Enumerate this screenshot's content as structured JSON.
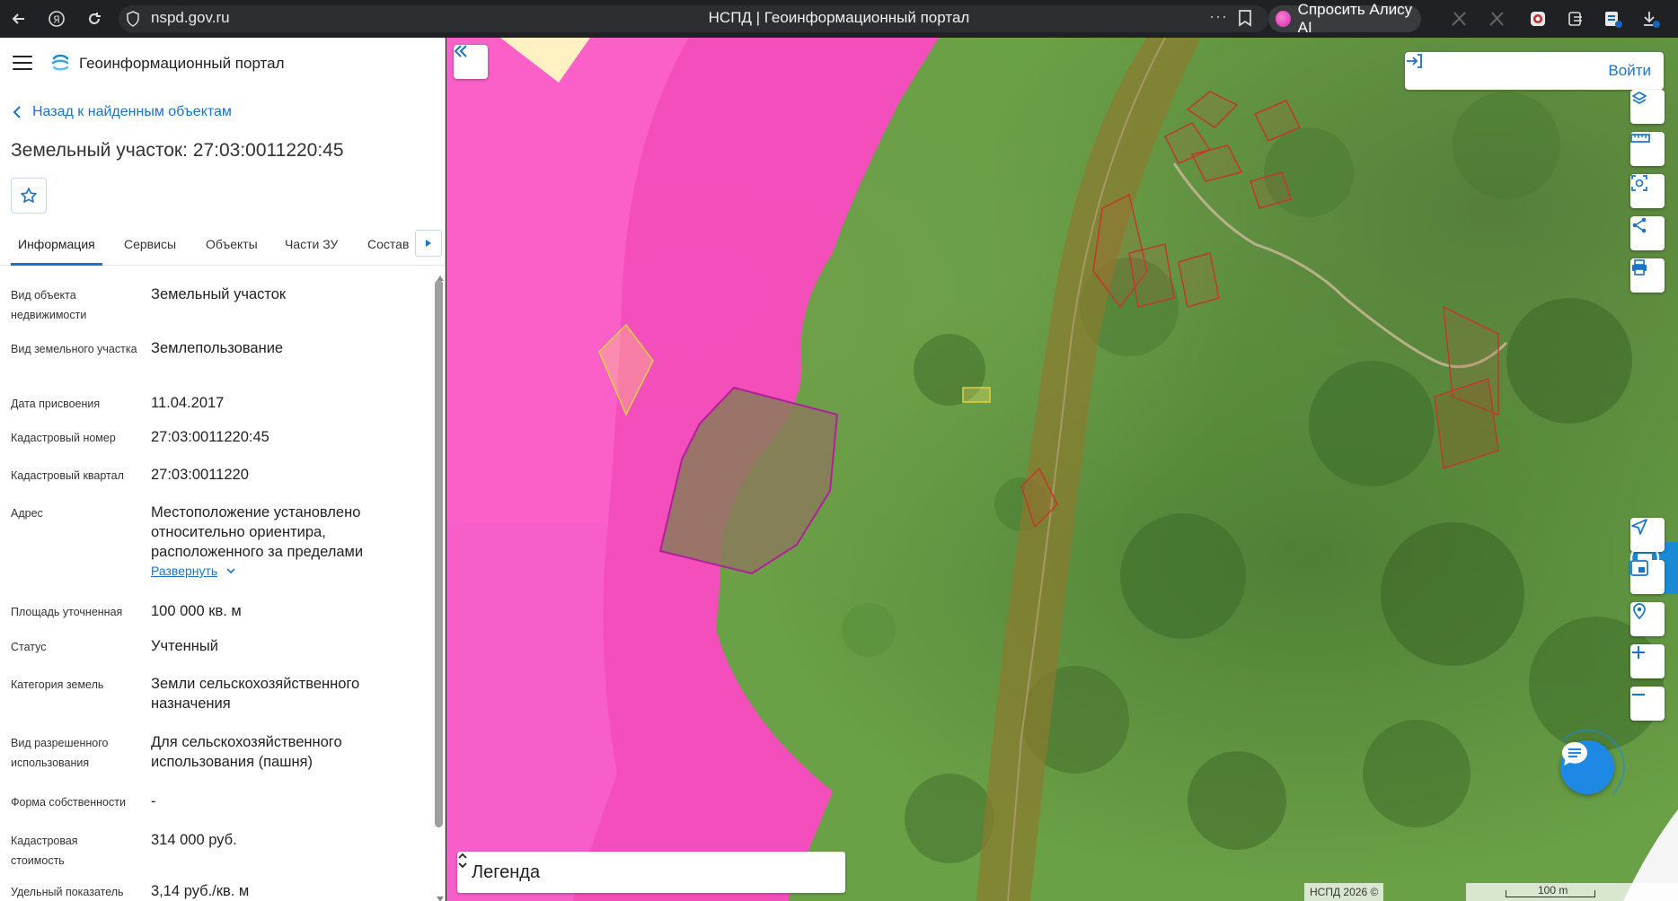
{
  "browser": {
    "url": "nspd.gov.ru",
    "tab_title": "НСПД | Геоинформационный портал",
    "more_label": "···",
    "alice_label": "Спросить Алису AI"
  },
  "header": {
    "portal_title": "Геоинформационный портал"
  },
  "panel": {
    "back_label": "Назад к найденным объектам",
    "title": "Земельный участок: 27:03:0011220:45",
    "tabs": [
      "Информация",
      "Сервисы",
      "Объекты",
      "Части ЗУ",
      "Состав"
    ],
    "expand_label": "Развернуть",
    "attributes": [
      {
        "label": "Вид объекта недвижимости",
        "value": "Земельный участок"
      },
      {
        "label": "Вид земельного участка",
        "value": "Землепользование"
      },
      {
        "label": "Дата присвоения",
        "value": "11.04.2017"
      },
      {
        "label": "Кадастровый номер",
        "value": "27:03:0011220:45"
      },
      {
        "label": "Кадастровый квартал",
        "value": "27:03:0011220"
      },
      {
        "label": "Адрес",
        "value": "Местоположение установлено относительно ориентира, расположенного за пределами"
      },
      {
        "label": "Площадь уточненная",
        "value": "100 000 кв. м"
      },
      {
        "label": "Статус",
        "value": "Учтенный"
      },
      {
        "label": "Категория земель",
        "value": "Земли сельскохозяйственного назначения"
      },
      {
        "label": "Вид разрешенного использования",
        "value": "Для сельскохозяйственного использования (пашня)"
      },
      {
        "label": "Форма собственности",
        "value": "-"
      },
      {
        "label": "Кадастровая стоимость",
        "value": "314 000 руб."
      },
      {
        "label": "Удельный показатель",
        "value": "3,14 руб./кв. м"
      }
    ]
  },
  "map": {
    "login_label": "Войти",
    "legend_label": "Легенда",
    "attribution": "НСПД 2026 ©",
    "scale_label": "100 m",
    "colors": {
      "zone_pink": "#ff4fc8",
      "zone_pink_light": "#ff6fd2",
      "parcel_fill": "#8a7a5a",
      "parcel_stroke": "#b0209a",
      "road_band": "#8c7a2e",
      "accent": "#1a73c8"
    }
  }
}
